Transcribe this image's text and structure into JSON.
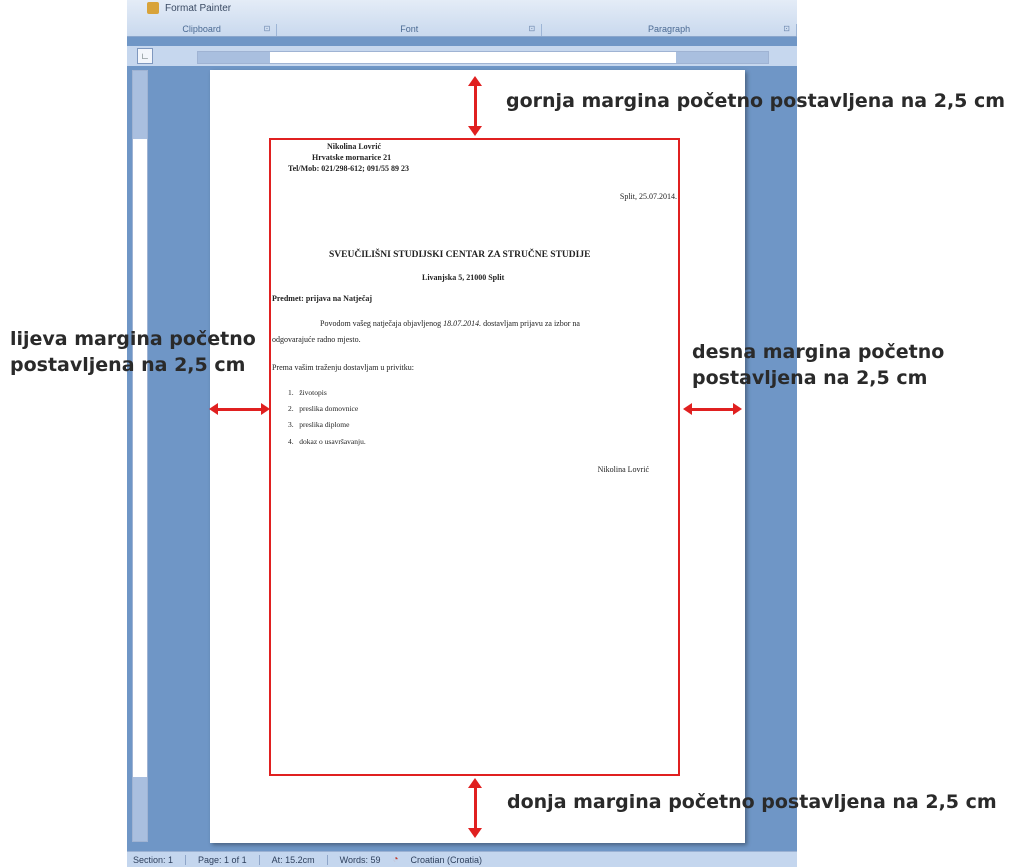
{
  "ribbon": {
    "format_painter": "Format Painter",
    "groups": [
      {
        "label": "Clipboard"
      },
      {
        "label": "Font"
      },
      {
        "label": "Paragraph"
      }
    ]
  },
  "status_bar": {
    "section": "Section: 1",
    "page": "Page: 1 of 1",
    "at": "At: 15.2cm",
    "words": "Words: 59",
    "language": "Croatian (Croatia)"
  },
  "document": {
    "sender_name": "Nikolina Lovrić",
    "sender_street": "Hrvatske mornarice 21",
    "sender_tel_label": "Tel/Mob:",
    "sender_tel": "021/298-612;  091/55 89 23",
    "date": "Split, 25.07.2014.",
    "institution": "SVEUČILIŠNI STUDIJSKI CENTAR ZA STRUČNE STUDIJE",
    "institution_address": "Livanjska 5, 21000 Split",
    "subject_label": "Predmet:",
    "subject": "prijava na Natječaj",
    "paragraph_start": "Povodom vašeg natječaja objavljenog",
    "paragraph_date": "18.07.2014.",
    "paragraph_end": "dostavljam prijavu za izbor na",
    "paragraph_line2": "odgovarajuće radno mjesto.",
    "attachments_intro": "Prema vašim traženju dostavljam u privitku:",
    "attachments": [
      {
        "num": "1.",
        "text": "životopis"
      },
      {
        "num": "2.",
        "text": "preslika domovnice"
      },
      {
        "num": "3.",
        "text": "preslika diplome"
      },
      {
        "num": "4.",
        "text": "dokaz o usavršavanju."
      }
    ],
    "signature": "Nikolina Lovrić"
  },
  "annotations": {
    "top": "gornja margina početno postavljena na 2,5 cm",
    "left_line1": "lijeva margina početno",
    "left_line2": "postavljena na 2,5 cm",
    "right_line1": "desna margina početno",
    "right_line2": "postavljena na 2,5 cm",
    "bottom": "donja margina početno postavljena na 2,5 cm"
  },
  "colors": {
    "margin_marker": "#e02020",
    "word_background": "#6f96c6",
    "ribbon": "#c9d9ee"
  }
}
